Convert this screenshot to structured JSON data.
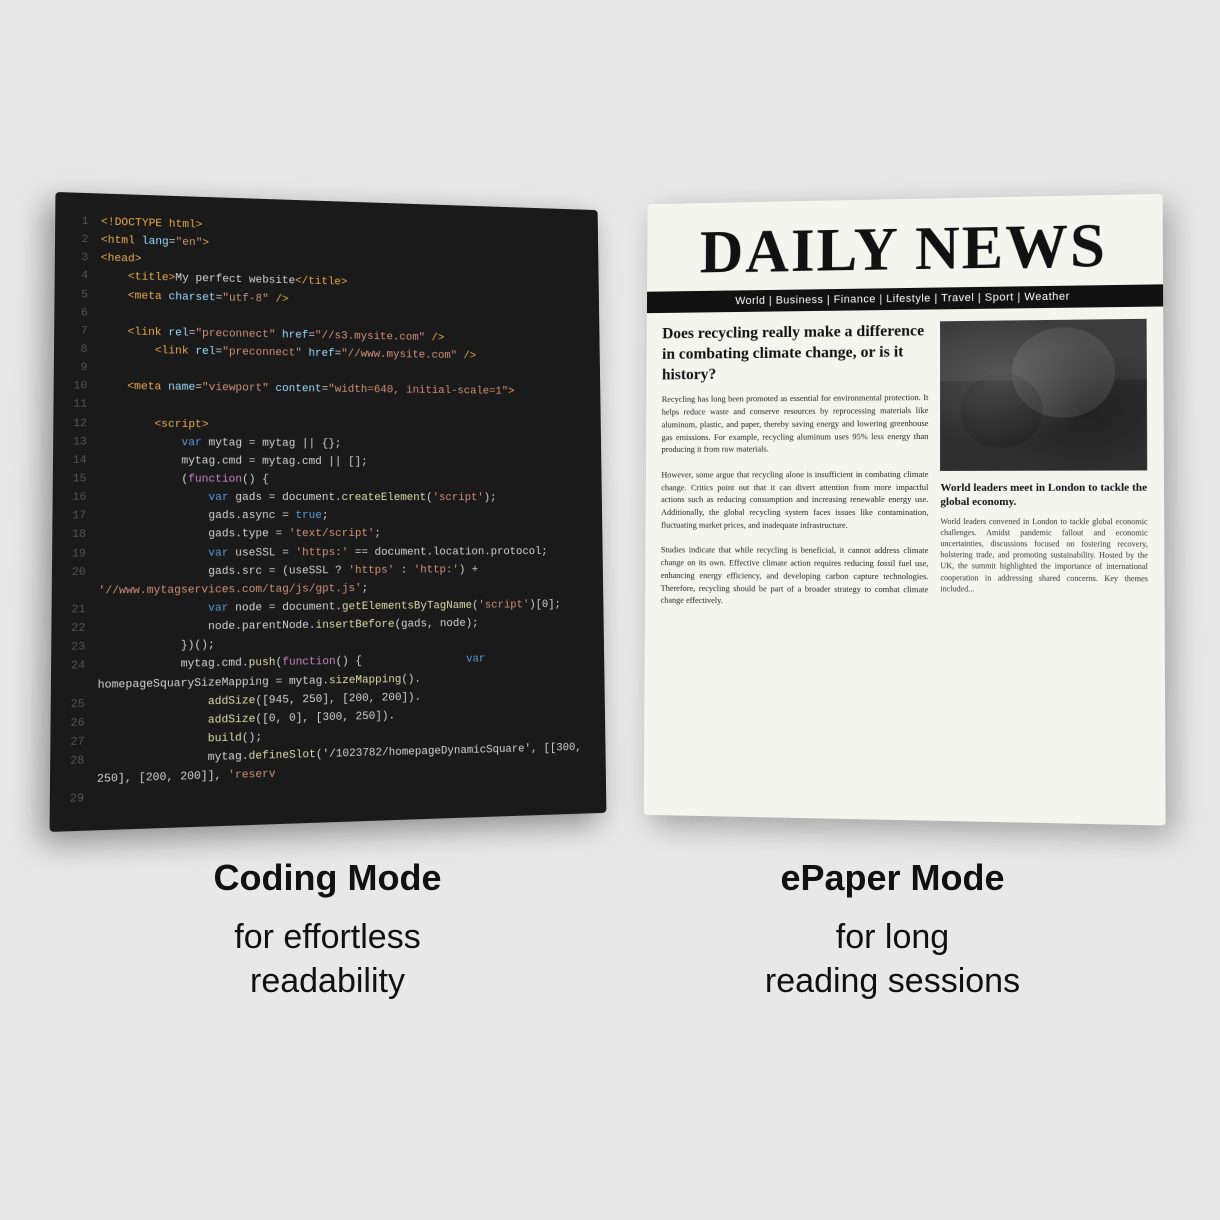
{
  "layout": {
    "bg_color": "#e8e8e8"
  },
  "coding_mode": {
    "title": "Coding Mode",
    "subtitle": "for effortless\nreadability",
    "code_lines": [
      {
        "num": "1",
        "html": "<span class='tag'>&lt;!DOCTYPE html&gt;</span>"
      },
      {
        "num": "2",
        "html": "<span class='tag'>&lt;html</span> <span class='attr'>lang</span>=<span class='val'>\"en\"</span><span class='tag'>&gt;</span>"
      },
      {
        "num": "3",
        "html": "<span class='tag'>&lt;head&gt;</span>"
      },
      {
        "num": "4",
        "html": "&nbsp;&nbsp;&nbsp;&nbsp;<span class='tag'>&lt;title&gt;</span>My perfect website<span class='tag'>&lt;/title&gt;</span>"
      },
      {
        "num": "5",
        "html": "&nbsp;&nbsp;&nbsp;&nbsp;<span class='tag'>&lt;meta</span> <span class='attr'>charset</span>=<span class='val'>\"utf-8\"</span> <span class='tag'>/&gt;</span>"
      },
      {
        "num": "6",
        "html": ""
      },
      {
        "num": "7",
        "html": "&nbsp;&nbsp;&nbsp;&nbsp;<span class='tag'>&lt;link</span> <span class='attr'>rel</span>=<span class='val'>\"preconnect\"</span> <span class='attr'>href</span>=<span class='val'>\"//s3.mysite.com\"</span> <span class='tag'>/&gt;</span>"
      },
      {
        "num": "8",
        "html": "&nbsp;&nbsp;&nbsp;&nbsp;&nbsp;&nbsp;&nbsp;&nbsp;<span class='tag'>&lt;link</span> <span class='attr'>rel</span>=<span class='val'>\"preconnect\"</span> <span class='attr'>href</span>=<span class='val'>\"//www.mysite.com\"</span> <span class='tag'>/&gt;</span>"
      },
      {
        "num": "9",
        "html": ""
      },
      {
        "num": "10",
        "html": "&nbsp;&nbsp;&nbsp;&nbsp;<span class='tag'>&lt;meta</span> <span class='attr'>name</span>=<span class='val'>\"viewport\"</span> <span class='attr'>content</span>=<span class='val'>\"width=640, initial-scale=1\"</span><span class='tag'>&gt;</span>"
      },
      {
        "num": "11",
        "html": ""
      },
      {
        "num": "12",
        "html": "&nbsp;&nbsp;&nbsp;&nbsp;&nbsp;&nbsp;&nbsp;&nbsp;<span class='tag'>&lt;script&gt;</span>"
      },
      {
        "num": "13",
        "html": "&nbsp;&nbsp;&nbsp;&nbsp;&nbsp;&nbsp;&nbsp;&nbsp;&nbsp;&nbsp;&nbsp;&nbsp;<span class='var-keyword'>var</span> mytag = mytag || {};"
      },
      {
        "num": "14",
        "html": "&nbsp;&nbsp;&nbsp;&nbsp;&nbsp;&nbsp;&nbsp;&nbsp;&nbsp;&nbsp;&nbsp;&nbsp;mytag.cmd = mytag.cmd || [];"
      },
      {
        "num": "15",
        "html": "&nbsp;&nbsp;&nbsp;&nbsp;&nbsp;&nbsp;&nbsp;&nbsp;&nbsp;&nbsp;&nbsp;&nbsp;(<span class='keyword'>function</span>() {"
      },
      {
        "num": "16",
        "html": "&nbsp;&nbsp;&nbsp;&nbsp;&nbsp;&nbsp;&nbsp;&nbsp;&nbsp;&nbsp;&nbsp;&nbsp;&nbsp;&nbsp;&nbsp;&nbsp;<span class='var-keyword'>var</span> gads = document.<span class='func'>createElement</span>(<span class='string'>'script'</span>);"
      },
      {
        "num": "17",
        "html": "&nbsp;&nbsp;&nbsp;&nbsp;&nbsp;&nbsp;&nbsp;&nbsp;&nbsp;&nbsp;&nbsp;&nbsp;&nbsp;&nbsp;&nbsp;&nbsp;gads.async = <span class='var-keyword'>true</span>;"
      },
      {
        "num": "18",
        "html": "&nbsp;&nbsp;&nbsp;&nbsp;&nbsp;&nbsp;&nbsp;&nbsp;&nbsp;&nbsp;&nbsp;&nbsp;&nbsp;&nbsp;&nbsp;&nbsp;gads.type = <span class='string'>'text/script'</span>;"
      },
      {
        "num": "19",
        "html": "&nbsp;&nbsp;&nbsp;&nbsp;&nbsp;&nbsp;&nbsp;&nbsp;&nbsp;&nbsp;&nbsp;&nbsp;&nbsp;&nbsp;&nbsp;&nbsp;<span class='var-keyword'>var</span> useSSL = <span class='string'>'https:'</span> == document.location.protocol;"
      },
      {
        "num": "20",
        "html": "&nbsp;&nbsp;&nbsp;&nbsp;&nbsp;&nbsp;&nbsp;&nbsp;&nbsp;&nbsp;&nbsp;&nbsp;&nbsp;&nbsp;&nbsp;&nbsp;gads.src = (useSSL ? <span class='string'>'https'</span> : <span class='string'>'http:'</span>) + <span class='string'>'//www.mytagservices.com/tag/js/gpt.js'</span>;"
      },
      {
        "num": "21",
        "html": "&nbsp;&nbsp;&nbsp;&nbsp;&nbsp;&nbsp;&nbsp;&nbsp;&nbsp;&nbsp;&nbsp;&nbsp;&nbsp;&nbsp;&nbsp;&nbsp;<span class='var-keyword'>var</span> node = document.<span class='func'>getElementsByTagName</span>(<span class='string'>'script'</span>)[0];"
      },
      {
        "num": "22",
        "html": "&nbsp;&nbsp;&nbsp;&nbsp;&nbsp;&nbsp;&nbsp;&nbsp;&nbsp;&nbsp;&nbsp;&nbsp;&nbsp;&nbsp;&nbsp;&nbsp;node.parentNode.<span class='func'>insertBefore</span>(gads, node);"
      },
      {
        "num": "23",
        "html": "&nbsp;&nbsp;&nbsp;&nbsp;&nbsp;&nbsp;&nbsp;&nbsp;&nbsp;&nbsp;&nbsp;&nbsp;})();"
      },
      {
        "num": "24",
        "html": "&nbsp;&nbsp;&nbsp;&nbsp;&nbsp;&nbsp;&nbsp;&nbsp;&nbsp;&nbsp;&nbsp;&nbsp;mytag.cmd.<span class='func'>push</span>(<span class='keyword'>function</span>() {&nbsp;&nbsp;&nbsp;&nbsp;&nbsp;&nbsp;&nbsp;&nbsp;&nbsp;&nbsp;&nbsp;&nbsp;&nbsp;&nbsp;&nbsp;&nbsp;<span class='var-keyword'>var</span> homepageSquarySizeMapping = mytag.<span class='func'>sizeMapping</span>()."
      },
      {
        "num": "25",
        "html": "&nbsp;&nbsp;&nbsp;&nbsp;&nbsp;&nbsp;&nbsp;&nbsp;&nbsp;&nbsp;&nbsp;&nbsp;&nbsp;&nbsp;&nbsp;&nbsp;<span class='func'>addSize</span>([945, 250], [200, 200])."
      },
      {
        "num": "26",
        "html": "&nbsp;&nbsp;&nbsp;&nbsp;&nbsp;&nbsp;&nbsp;&nbsp;&nbsp;&nbsp;&nbsp;&nbsp;&nbsp;&nbsp;&nbsp;&nbsp;<span class='func'>addSize</span>([0, 0], [300, 250])."
      },
      {
        "num": "27",
        "html": "&nbsp;&nbsp;&nbsp;&nbsp;&nbsp;&nbsp;&nbsp;&nbsp;&nbsp;&nbsp;&nbsp;&nbsp;&nbsp;&nbsp;&nbsp;&nbsp;<span class='func'>build</span>();"
      },
      {
        "num": "28",
        "html": "&nbsp;&nbsp;&nbsp;&nbsp;&nbsp;&nbsp;&nbsp;&nbsp;&nbsp;&nbsp;&nbsp;&nbsp;&nbsp;&nbsp;&nbsp;&nbsp;mytag.<span class='func'>defineSlot</span>('/1023782/homepageDynamicSquare', [[300, 250], [200, 200]], <span class='string'>'reserv</span>"
      },
      {
        "num": "29",
        "html": ""
      }
    ]
  },
  "epaper_mode": {
    "title": "ePaper Mode",
    "subtitle": "for long\nreading sessions",
    "newspaper": {
      "title": "DAILY NEWS",
      "nav": "World  |  Business  |  Finance  |  Lifestyle  |  Travel  |  Sport  |  Weather",
      "headline": "Does recycling really make a difference in combating climate change, or is it history?",
      "body": "Recycling has long been promoted as essential for environmental protection. It helps reduce waste and conserve resources by reprocessing materials like aluminum, plastic, and paper, thereby saving energy and lowering greenhouse gas emissions. For example, recycling aluminum uses 95% less energy than producing it from raw materials.\n\nHowever, some argue that recycling alone is insufficient in combating climate change. Critics point out that it can divert attention from more impactful actions such as reducing consumption and increasing renewable energy use. Additionally, the global recycling system faces issues like contamination, fluctuating market prices, and inadequate infrastructure.\n\nStudies indicate that while recycling is beneficial, it cannot address climate change on its own. Effective climate action requires reducing fossil fuel use, enhancing energy efficiency, and developing carbon capture technologies. Therefore, recycling should be part of a broader strategy to combat climate change effectively.",
      "side_headline": "World leaders meet in London to tackle the global economy.",
      "side_body": "World leaders convened in London to tackle global economic challenges. Amidst pandemic fallout and economic uncertainties, discussions focused on fostering recovery, bolstering trade, and promoting sustainability. Hosted by the UK, the summit highlighted the importance of international cooperation in addressing shared concerns. Key themes included..."
    }
  }
}
